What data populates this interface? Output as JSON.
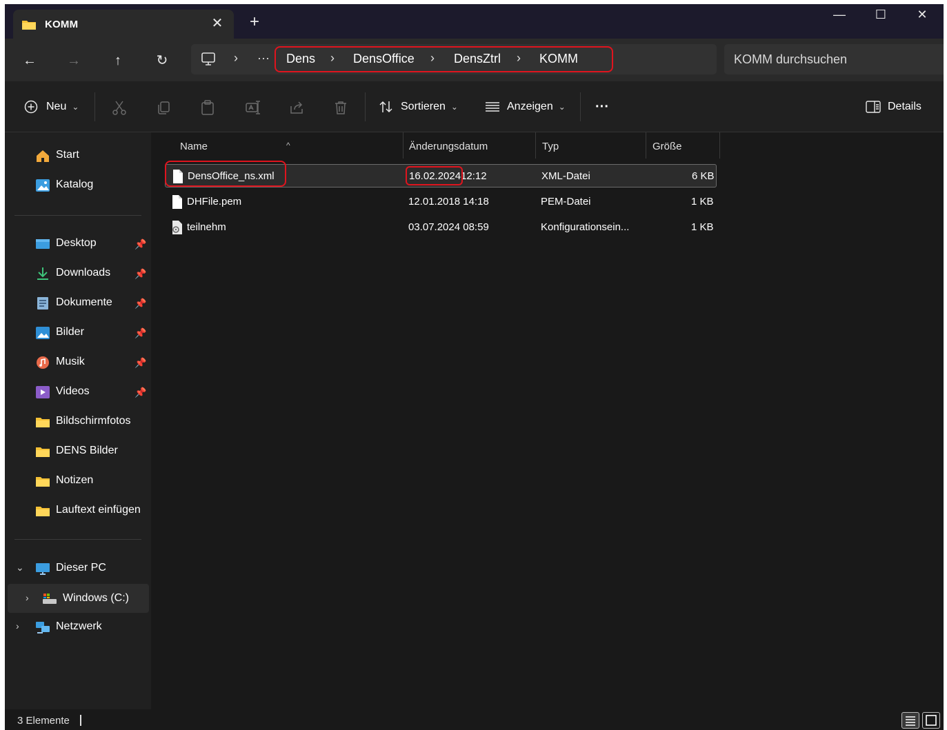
{
  "window": {
    "tab_title": "KOMM",
    "close_tab": "✕",
    "new_tab": "+",
    "controls": {
      "minimize": "—",
      "maximize": "☐",
      "close": "✕"
    }
  },
  "address": {
    "back": "←",
    "forward": "→",
    "up": "↑",
    "refresh": "↻",
    "more": "···",
    "chevron": "›",
    "breadcrumbs": [
      "Dens",
      "DensOffice",
      "DensZtrl",
      "KOMM"
    ],
    "search_placeholder": "KOMM durchsuchen"
  },
  "toolbar": {
    "new_label": "Neu",
    "sort_label": "Sortieren",
    "view_label": "Anzeigen",
    "more_label": "···",
    "details_label": "Details",
    "caret": "⌄"
  },
  "sidebar": {
    "quick": [
      {
        "label": "Start",
        "icon": "home-icon"
      },
      {
        "label": "Katalog",
        "icon": "gallery-icon"
      }
    ],
    "pinned": [
      {
        "label": "Desktop",
        "icon": "desktop-icon",
        "pin": "📌"
      },
      {
        "label": "Downloads",
        "icon": "download-icon",
        "pin": "📌"
      },
      {
        "label": "Dokumente",
        "icon": "documents-icon",
        "pin": "📌"
      },
      {
        "label": "Bilder",
        "icon": "pictures-icon",
        "pin": "📌"
      },
      {
        "label": "Musik",
        "icon": "music-icon",
        "pin": "📌"
      },
      {
        "label": "Videos",
        "icon": "videos-icon",
        "pin": "📌"
      },
      {
        "label": "Bildschirmfotos",
        "icon": "folder-icon"
      },
      {
        "label": "DENS Bilder",
        "icon": "folder-icon"
      },
      {
        "label": "Notizen",
        "icon": "folder-icon"
      },
      {
        "label": "Lauftext einfügen",
        "icon": "folder-icon"
      }
    ],
    "this_pc": "Dieser PC",
    "drive": "Windows (C:)",
    "network": "Netzwerk",
    "expand_open": "⌄",
    "expand_closed": "›"
  },
  "columns": {
    "name": "Name",
    "date": "Änderungsdatum",
    "type": "Typ",
    "size": "Größe",
    "sort_indicator": "^"
  },
  "files": [
    {
      "name": "DensOffice_ns.xml",
      "date_day": "16.02.2024",
      "date_time": "12:12",
      "type": "XML-Datei",
      "size": "6 KB",
      "icon": "file-icon"
    },
    {
      "name": "DHFile.pem",
      "date_day": "12.01.2018",
      "date_time": "14:18",
      "type": "PEM-Datei",
      "size": "1 KB",
      "icon": "file-icon"
    },
    {
      "name": "teilnehm",
      "date_day": "03.07.2024",
      "date_time": "08:59",
      "type": "Konfigurationsein...",
      "size": "1 KB",
      "icon": "config-file-icon"
    }
  ],
  "status": {
    "count": "3 Elemente"
  },
  "colors": {
    "background": "#191919",
    "sidebar": "#202020",
    "highlight_red": "#e0141e",
    "folder_yellow": "#f5c136",
    "accent_blue": "#3b9de0"
  }
}
